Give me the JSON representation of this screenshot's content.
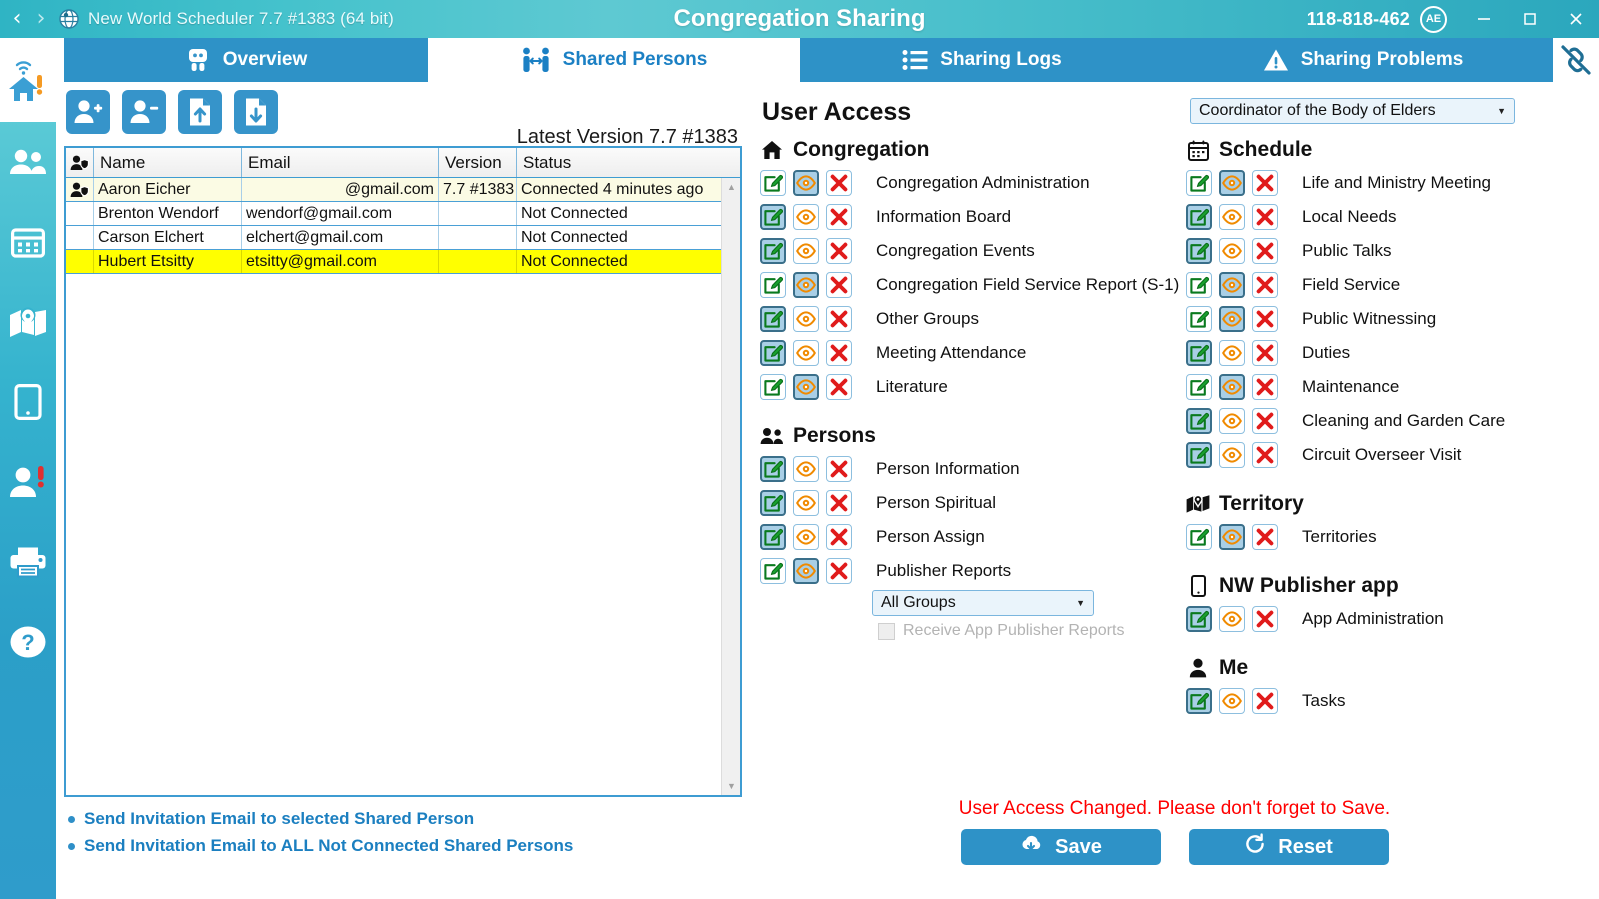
{
  "titlebar": {
    "app_title": "New World Scheduler 7.7 #1383 (64 bit)",
    "window_title": "Congregation Sharing",
    "license_number": "118-818-462",
    "avatar_initials": "AE",
    "back_icon": "chevron-left-icon",
    "forward_icon": "chevron-right-icon",
    "minimize_label": "–",
    "maximize_label": "☐",
    "close_label": "×"
  },
  "sidebar": {
    "items": [
      {
        "name": "wifi-home-status",
        "icon": "home-alert-icon"
      },
      {
        "name": "persons",
        "icon": "people-icon"
      },
      {
        "name": "schedule",
        "icon": "calendar-icon"
      },
      {
        "name": "territory",
        "icon": "map-icon"
      },
      {
        "name": "publisher-app",
        "icon": "tablet-icon"
      },
      {
        "name": "me",
        "icon": "person-alert-icon"
      },
      {
        "name": "print",
        "icon": "printer-icon"
      },
      {
        "name": "help",
        "icon": "question-circle-icon"
      }
    ]
  },
  "tabs": [
    {
      "label": "Overview",
      "icon": "overview-icon",
      "active": false
    },
    {
      "label": "Shared Persons",
      "icon": "shared-persons-icon",
      "active": true
    },
    {
      "label": "Sharing Logs",
      "icon": "list-icon",
      "active": false
    },
    {
      "label": "Sharing Problems",
      "icon": "warning-icon",
      "active": false
    }
  ],
  "top_right": {
    "unlink_icon": "broken-link-icon",
    "help_icon": "question-circle-icon"
  },
  "left_panel": {
    "toolbar": [
      {
        "name": "add-shared-person-button",
        "icon": "user-plus-icon"
      },
      {
        "name": "remove-shared-person-button",
        "icon": "user-minus-icon"
      },
      {
        "name": "export-button",
        "icon": "file-up-icon"
      },
      {
        "name": "import-button",
        "icon": "file-down-icon"
      }
    ],
    "latest_version": "Latest Version 7.7  #1383",
    "table": {
      "columns": [
        "",
        "Name",
        "Email",
        "Version",
        "Status"
      ],
      "rows": [
        {
          "icon": "person-shield-icon",
          "name": "Aaron Eicher",
          "email": "@gmail.com",
          "email_align": "right",
          "version": "7.7 #1383",
          "status": "Connected 4 minutes ago",
          "state": "selected"
        },
        {
          "icon": "",
          "name": "Brenton Wendorf",
          "email": "wendorf@gmail.com",
          "email_align": "left",
          "version": "",
          "status": "Not Connected",
          "state": "normal"
        },
        {
          "icon": "",
          "name": "Carson Elchert",
          "email": "elchert@gmail.com",
          "email_align": "left",
          "version": "",
          "status": "Not Connected",
          "state": "normal"
        },
        {
          "icon": "",
          "name": "Hubert Etsitty",
          "email": "etsitty@gmail.com",
          "email_align": "left",
          "version": "",
          "status": "Not Connected",
          "state": "highlighted"
        }
      ]
    },
    "links": [
      "Send Invitation Email to selected Shared Person",
      "Send Invitation Email to ALL Not Connected Shared Persons"
    ]
  },
  "user_access": {
    "title": "User Access",
    "role": "Coordinator of the Body of Elders",
    "groups_left": [
      {
        "title": "Congregation",
        "icon": "home-icon",
        "items": [
          {
            "label": "Congregation Administration",
            "selected": "view"
          },
          {
            "label": "Information Board",
            "selected": "edit"
          },
          {
            "label": "Congregation Events",
            "selected": "edit"
          },
          {
            "label": "Congregation Field Service Report (S-1)",
            "selected": "view"
          },
          {
            "label": "Other Groups",
            "selected": "edit"
          },
          {
            "label": "Meeting Attendance",
            "selected": "edit"
          },
          {
            "label": "Literature",
            "selected": "view"
          }
        ]
      },
      {
        "title": "Persons",
        "icon": "people-icon",
        "items": [
          {
            "label": "Person Information",
            "selected": "edit"
          },
          {
            "label": "Person Spiritual",
            "selected": "edit"
          },
          {
            "label": "Person Assign",
            "selected": "edit"
          },
          {
            "label": "Publisher Reports",
            "selected": "view"
          }
        ],
        "extra": {
          "group_select": "All Groups",
          "checkbox_label": "Receive App Publisher Reports",
          "checkbox_checked": false
        }
      }
    ],
    "groups_right": [
      {
        "title": "Schedule",
        "icon": "calendar-icon",
        "items": [
          {
            "label": "Life and Ministry Meeting",
            "selected": "view"
          },
          {
            "label": "Local Needs",
            "selected": "edit"
          },
          {
            "label": "Public Talks",
            "selected": "edit"
          },
          {
            "label": "Field Service",
            "selected": "view"
          },
          {
            "label": "Public Witnessing",
            "selected": "view"
          },
          {
            "label": "Duties",
            "selected": "edit"
          },
          {
            "label": "Maintenance",
            "selected": "view"
          },
          {
            "label": "Cleaning and Garden Care",
            "selected": "edit"
          },
          {
            "label": "Circuit Overseer Visit",
            "selected": "edit"
          }
        ]
      },
      {
        "title": "Territory",
        "icon": "map-icon",
        "items": [
          {
            "label": "Territories",
            "selected": "view"
          }
        ]
      },
      {
        "title": "NW Publisher app",
        "icon": "tablet-icon",
        "items": [
          {
            "label": "App Administration",
            "selected": "edit"
          }
        ]
      },
      {
        "title": "Me",
        "icon": "person-icon",
        "items": [
          {
            "label": "Tasks",
            "selected": "edit"
          }
        ]
      }
    ],
    "permission_icons": {
      "edit": "edit-pencil-icon",
      "view": "eye-icon",
      "none": "red-x-icon"
    }
  },
  "footer": {
    "warning": "User Access Changed. Please don't forget to Save.",
    "save_label": "Save",
    "save_icon": "cloud-download-icon",
    "reset_label": "Reset",
    "reset_icon": "refresh-icon"
  },
  "colors": {
    "title_gradient_start": "#2fb4c4",
    "title_gradient_end": "#2ba7bd",
    "tab_inactive": "#2e92c7",
    "tab_active_text": "#1b80c4",
    "link_blue": "#1b7fc0",
    "warning_red": "#ff0000",
    "highlight_yellow": "#ffff00",
    "selected_row": "#fbfbe4",
    "button_blue": "#2e92c7"
  }
}
